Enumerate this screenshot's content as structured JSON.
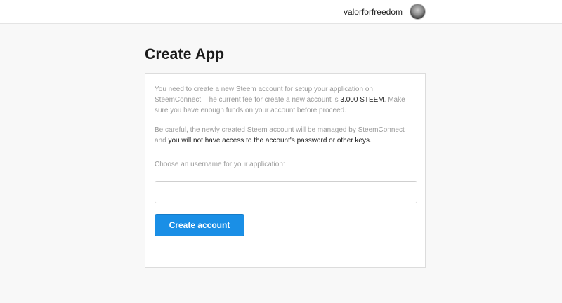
{
  "header": {
    "username": "valorforfreedom",
    "avatar_icon": "user-avatar"
  },
  "page": {
    "title": "Create App"
  },
  "card": {
    "para1": {
      "part1": "You need to create a new Steem account for setup your application on SteemConnect. The current fee for create a new account is ",
      "fee": "3.000 STEEM",
      "part2": ". Make sure you have enough funds on your account before proceed."
    },
    "para2": {
      "part1": "Be careful, the newly created Steem account will be managed by SteemConnect and ",
      "emphasis": "you will not have access to the account's password or other keys."
    },
    "choose_label": "Choose an username for your application:",
    "input_value": "",
    "input_placeholder": "",
    "button_label": "Create account"
  },
  "colors": {
    "accent": "#1a8fe6",
    "background": "#f8f8f8",
    "muted_text": "#9a9a9a"
  }
}
